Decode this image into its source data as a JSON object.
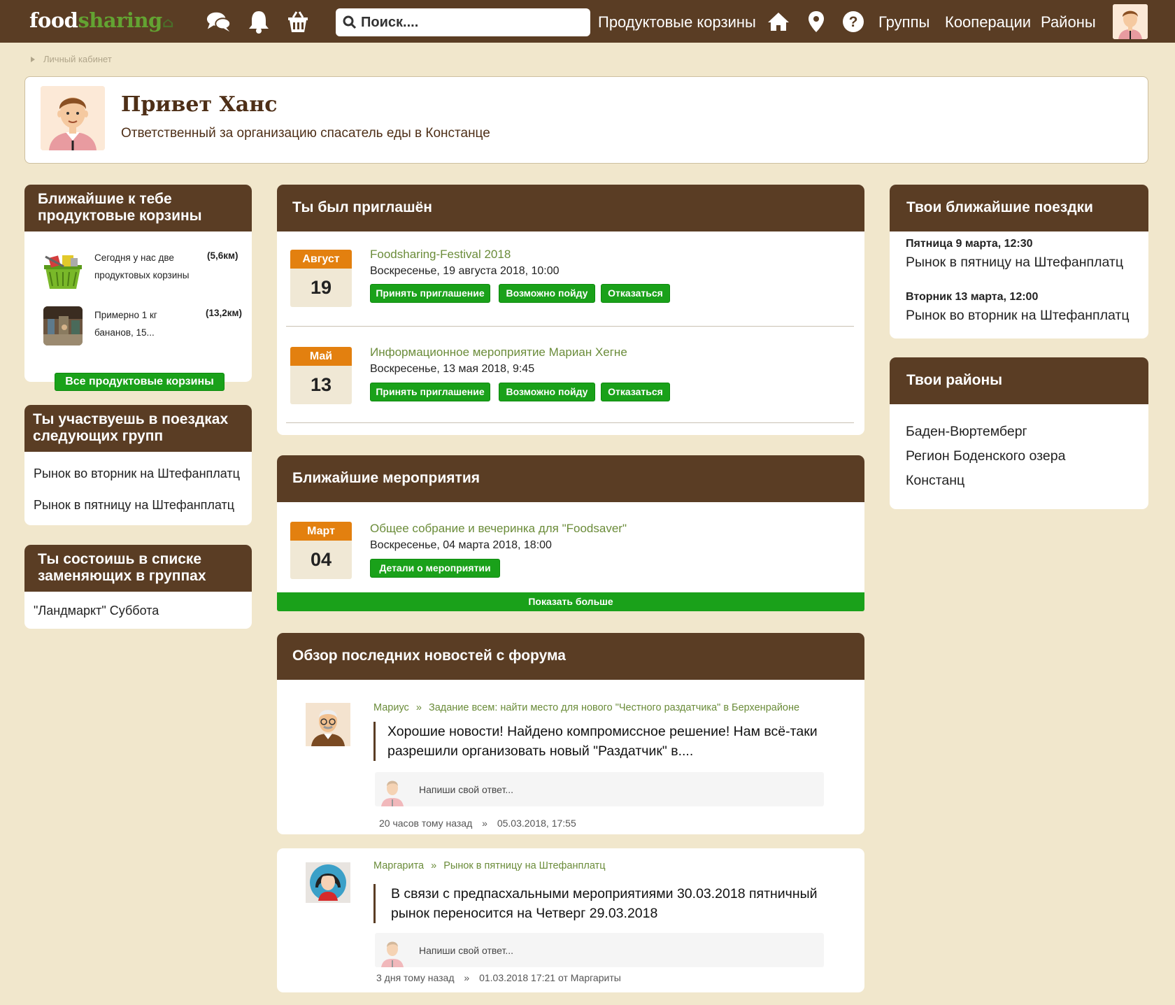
{
  "brand": {
    "part1": "food",
    "part2": "sharing"
  },
  "search": {
    "placeholder": "Поиск...."
  },
  "nav": {
    "baskets": "Продуктовые корзины",
    "groups": "Группы",
    "cooperations": "Кооперации",
    "districts": "Районы"
  },
  "breadcrumb": {
    "item": "Личный кабинет"
  },
  "welcome": {
    "greeting": "Привет Ханс",
    "role": "Ответственный за организацию спасатель еды в Констанце"
  },
  "baskets": {
    "title_line1": "Ближайшие к тебе",
    "title_line2": "продуктовые корзины",
    "items": [
      {
        "text_line1": "Сегодня у нас две",
        "text_line2": "продуктовых корзины",
        "distance": "(5,6км)"
      },
      {
        "text_line1": "Примерно 1 кг",
        "text_line2": "бананов, 15...",
        "distance": "(13,2км)"
      }
    ],
    "all_button": "Все продуктовые корзины"
  },
  "groups": {
    "title_line1": "Ты участвуешь в поездках",
    "title_line2": "следующих групп",
    "items": [
      "Рынок во вторник на Штефанплатц",
      "Рынок в пятницу на Штефанплатц"
    ]
  },
  "substitutes": {
    "title_line1": "Ты состоишь в списке",
    "title_line2": "заменяющих в группах",
    "items": [
      "\"Ландмаркт\" Суббота"
    ]
  },
  "invited": {
    "title": "Ты был приглашён",
    "events": [
      {
        "month": "Август",
        "day": "19",
        "title": "Foodsharing-Festival 2018",
        "date": "Воскресенье, 19 августа 2018, 10:00"
      },
      {
        "month": "Май",
        "day": "13",
        "title": "Информационное мероприятие Мариан Хегне",
        "date": "Воскресенье, 13 мая 2018, 9:45"
      }
    ],
    "accept": "Принять приглашение",
    "maybe": "Возможно пойду",
    "decline": "Отказаться"
  },
  "upcoming": {
    "title": "Ближайшие мероприятия",
    "events": [
      {
        "month": "Март",
        "day": "04",
        "title": "Общее собрание и вечеринка для \"Foodsaver\"",
        "date": "Воскресенье, 04 марта 2018, 18:00"
      }
    ],
    "details": "Детали о мероприятии",
    "show_more": "Показать больше"
  },
  "forum": {
    "title": "Обзор последних новостей с форума",
    "posts": [
      {
        "author": "Мариус",
        "sep": "»",
        "thread": "Задание всем: найти место для нового \"Честного раздатчика\" в Берхенрайоне",
        "line1": "Хорошие новости! Найдено компромиссное решение! Нам всё-таки",
        "line2": "разрешили организовать новый \"Раздатчик\" в....",
        "reply_placeholder": "Напиши свой ответ...",
        "time_ago": "20 часов тому назад",
        "timestamp": "05.03.2018, 17:55"
      },
      {
        "author": "Маргарита",
        "sep": "»",
        "thread": "Рынок в пятницу на Штефанплатц",
        "line1": "В связи с предпасхальными мероприятиями 30.03.2018 пятничный",
        "line2": "рынок переносится на Четверг 29.03.2018",
        "reply_placeholder": "Напиши свой ответ...",
        "time_ago": "3 дня тому назад",
        "timestamp": "01.03.2018 17:21 от Маргариты"
      }
    ]
  },
  "trips": {
    "title": "Твои ближайшие поездки",
    "items": [
      {
        "when": "Пятница 9 марта, 12:30",
        "what": "Рынок в пятницу на Штефанплатц"
      },
      {
        "when": "Вторник 13 марта, 12:00",
        "what": "Рынок во вторник на Штефанплатц"
      }
    ]
  },
  "regions": {
    "title": "Твои районы",
    "items": [
      "Баден-Вюртемберг",
      "Регион Боденского озера",
      "Констанц"
    ]
  },
  "colors": {
    "header_brown": "#5a3d24",
    "background": "#f1e7cc",
    "accent_green": "#1aa11a",
    "date_orange": "#e3800f",
    "link_green": "#6b8c3a"
  }
}
